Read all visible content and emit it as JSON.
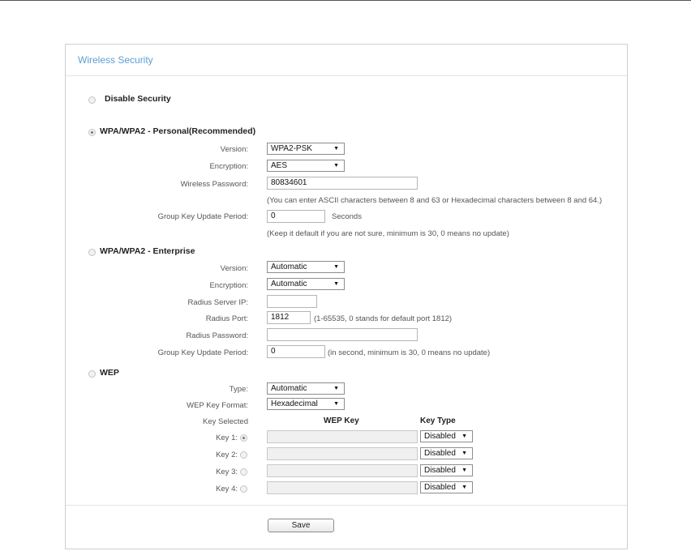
{
  "panel": {
    "title": "Wireless Security",
    "save_label": "Save"
  },
  "disable_security": {
    "label": "Disable Security",
    "selected": false
  },
  "wpa_personal": {
    "label": "WPA/WPA2 - Personal(Recommended)",
    "selected": true,
    "version_label": "Version:",
    "version_value": "WPA2-PSK",
    "encryption_label": "Encryption:",
    "encryption_value": "AES",
    "password_label": "Wireless Password:",
    "password_value": "80834601",
    "password_hint": "(You can enter ASCII characters between 8 and 63 or Hexadecimal characters between 8 and 64.)",
    "group_key_label": "Group Key Update Period:",
    "group_key_value": "0",
    "group_key_unit": "Seconds",
    "group_key_hint": "(Keep it default if you are not sure, minimum is 30, 0 means no update)"
  },
  "wpa_enterprise": {
    "label": "WPA/WPA2 - Enterprise",
    "selected": false,
    "version_label": "Version:",
    "version_value": "Automatic",
    "encryption_label": "Encryption:",
    "encryption_value": "Automatic",
    "radius_ip_label": "Radius Server IP:",
    "radius_ip_value": "",
    "radius_port_label": "Radius Port:",
    "radius_port_value": "1812",
    "radius_port_hint": "(1-65535, 0 stands for default port 1812)",
    "radius_password_label": "Radius Password:",
    "radius_password_value": "",
    "group_key_label": "Group Key Update Period:",
    "group_key_value": "0",
    "group_key_hint": "(in second, minimum is 30, 0 means no update)"
  },
  "wep": {
    "label": "WEP",
    "selected": false,
    "type_label": "Type:",
    "type_value": "Automatic",
    "format_label": "WEP Key Format:",
    "format_value": "Hexadecimal",
    "key_selected_header": "Key Selected",
    "wep_key_header": "WEP Key",
    "key_type_header": "Key Type",
    "keys": [
      {
        "label": "Key 1:",
        "value": "",
        "type": "Disabled",
        "selected": true
      },
      {
        "label": "Key 2:",
        "value": "",
        "type": "Disabled",
        "selected": false
      },
      {
        "label": "Key 3:",
        "value": "",
        "type": "Disabled",
        "selected": false
      },
      {
        "label": "Key 4:",
        "value": "",
        "type": "Disabled",
        "selected": false
      }
    ]
  }
}
